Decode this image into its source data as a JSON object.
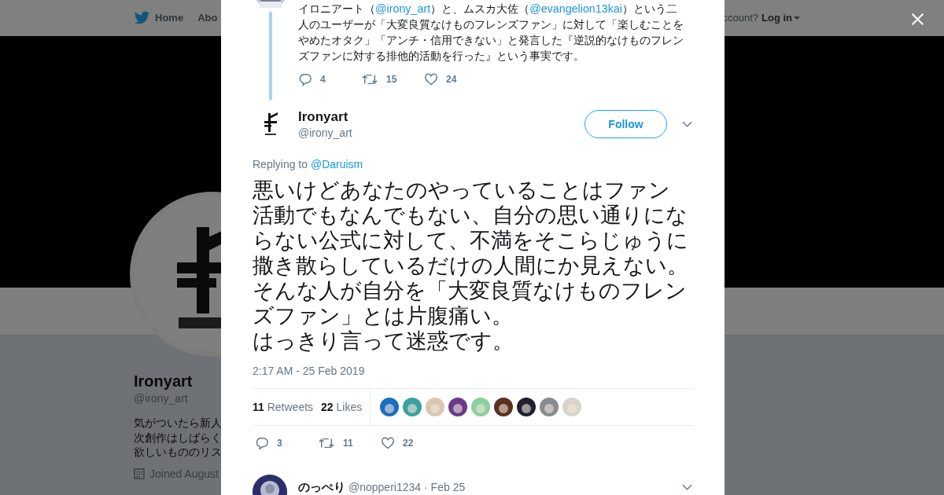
{
  "background_page": {
    "nav": [
      {
        "label": "Home"
      },
      {
        "label": "Abo"
      }
    ],
    "login_prompt": "ccount?",
    "login": "Log in",
    "profile": {
      "name": "Ironyart",
      "handle": "@irony_art",
      "bio": [
        "気がついたら新人",
        "次創作はしばらく",
        "欲しいもののリス"
      ],
      "joined": "Joined August"
    }
  },
  "parent_tweet": {
    "text": [
      {
        "text": "イロニアート（"
      },
      {
        "text": "@irony_art",
        "link": true
      },
      {
        "text": "）と、ムスカ大佐（"
      },
      {
        "text": "@evangelion13kai",
        "link": true
      },
      {
        "text": "）という二人のユーザーが「大変良質なけものフレンズファン」に対して「楽しむことをやめたオタク」「アンチ・信用できない」と発言した『逆説的なけものフレンズファンに対する排他的活動を行った』という事実です。"
      }
    ],
    "actions": [
      {
        "kind": "reply",
        "count": "4"
      },
      {
        "kind": "retweet",
        "count": "15"
      },
      {
        "kind": "like",
        "count": "24"
      }
    ]
  },
  "tweet": {
    "name": "Ironyart",
    "handle": "@irony_art",
    "follow": "Follow",
    "replying_label": "Replying to",
    "replying_to": "@Daruism",
    "text": [
      "悪いけどあなたのやっていることはファン",
      "活動でもなんでもない、自分の思い通りにならない公式に対して、不満をそこらじゅうに撒き散らしているだけの人間にか見えない。そんな人が自分を「大変良質なけものフレンズファン」とは片腹痛い。",
      "はっきり言って迷惑です。"
    ],
    "time": "2:17 AM - 25 Feb 2019",
    "stats": [
      {
        "count": "11",
        "label": "Retweets"
      },
      {
        "count": "22",
        "label": "Likes"
      }
    ],
    "likers": [
      {
        "color": "#1a6fc0"
      },
      {
        "color": "#3aa0a0"
      },
      {
        "color": "#d8c8b0"
      },
      {
        "color": "#6a3a8a"
      },
      {
        "color": "#8ad0a0"
      },
      {
        "color": "#5a3020"
      },
      {
        "color": "#202030"
      },
      {
        "color": "#8a8a90"
      },
      {
        "color": "#d8d4cc"
      }
    ],
    "actions": [
      {
        "kind": "reply",
        "count": "3"
      },
      {
        "kind": "retweet",
        "count": "11"
      },
      {
        "kind": "like",
        "count": "22"
      }
    ]
  },
  "next_reply": {
    "name": "のっぺり",
    "handle": "@nopperi1234",
    "date": "· Feb 25"
  }
}
